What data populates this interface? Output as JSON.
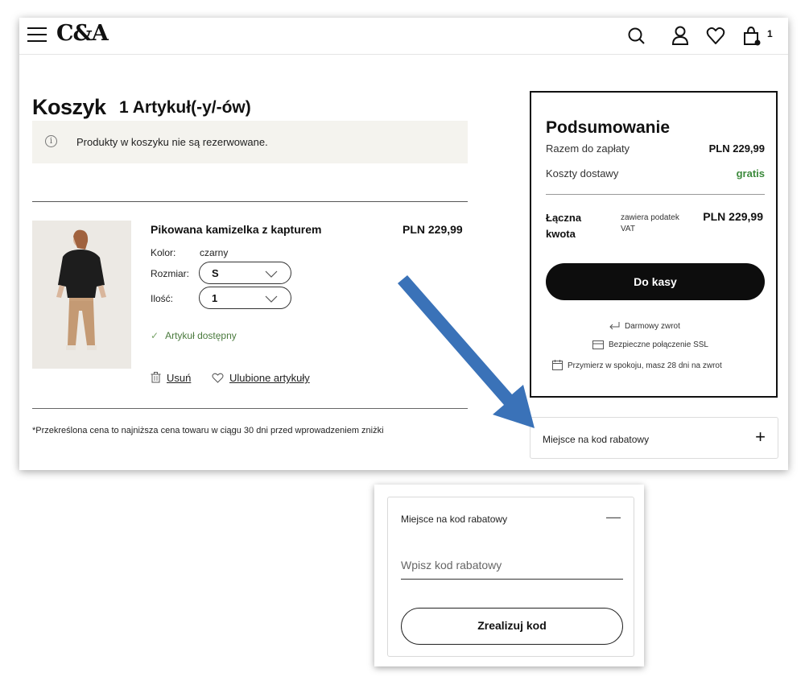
{
  "header": {
    "logo": "C&A",
    "cart_count": "1"
  },
  "cart": {
    "title": "Koszyk",
    "item_count_label": "1 Artykuł(-y/-ów)",
    "notice": "Produkty w koszyku nie są rezerwowane.",
    "product": {
      "name": "Pikowana kamizelka z kapturem",
      "price": "PLN 229,99",
      "color_label": "Kolor:",
      "color_value": "czarny",
      "size_label": "Rozmiar:",
      "size_value": "S",
      "qty_label": "Ilość:",
      "qty_value": "1",
      "availability": "Artykuł dostępny",
      "remove_label": "Usuń",
      "favorite_label": "Ulubione artykuły"
    },
    "footnote": "*Przekreślona cena to najniższa cena towaru w ciągu 30 dni przed wprowadzeniem zniżki"
  },
  "summary": {
    "title": "Podsumowanie",
    "subtotal_label": "Razem do zapłaty",
    "subtotal_value": "PLN 229,99",
    "shipping_label": "Koszty dostawy",
    "shipping_value": "gratis",
    "total_label": "Łączna kwota",
    "total_note": "zawiera podatek VAT",
    "total_value": "PLN 229,99",
    "checkout_label": "Do kasy",
    "features": [
      "Darmowy zwrot",
      "Bezpieczne połączenie SSL",
      "Przymierz w spokoju, masz 28 dni na zwrot"
    ]
  },
  "coupon_collapsed": {
    "label": "Miejsce na kod rabatowy",
    "toggle": "+"
  },
  "coupon_expanded": {
    "label": "Miejsce na kod rabatowy",
    "toggle": "—",
    "input_placeholder": "Wpisz kod rabatowy",
    "button_label": "Zrealizuj kod"
  },
  "colors": {
    "accent_arrow": "#3a72b8",
    "available_green": "#4a7a3d",
    "free_green": "#3c8a3c",
    "notice_bg": "#f4f3ee"
  }
}
